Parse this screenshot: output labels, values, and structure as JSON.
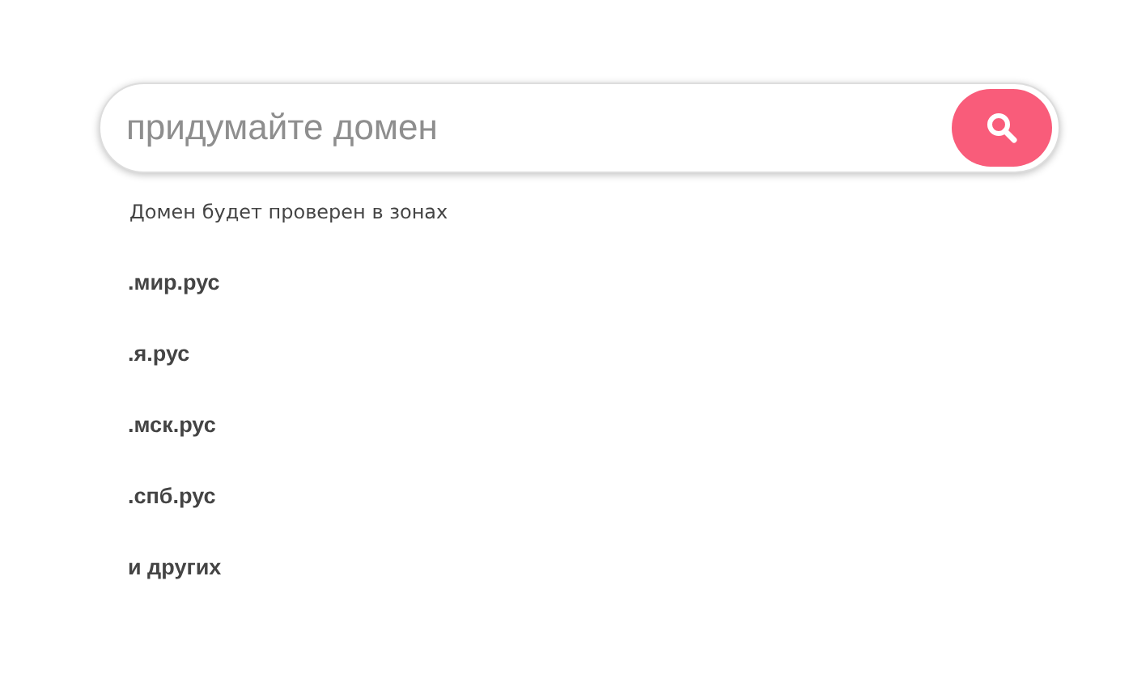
{
  "search": {
    "placeholder": "придумайте домен"
  },
  "hint": "Домен будет проверен в зонах",
  "zones": [
    ".мир.рус",
    ".я.рус",
    ".мск.рус",
    ".спб.рус",
    "и других"
  ]
}
